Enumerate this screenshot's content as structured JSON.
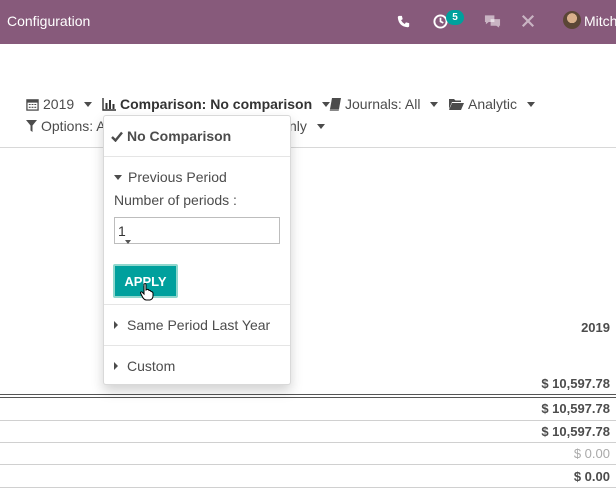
{
  "header": {
    "title": "Configuration",
    "activity_count": "5",
    "user_name": "Mitch",
    "icons": [
      "phone-icon",
      "clock-icon",
      "chat-icon",
      "tools-icon",
      "avatar"
    ]
  },
  "filters": {
    "year_label": "2019",
    "comparison_label": "Comparison: No comparison",
    "journals_label": "Journals: All",
    "analytic_label": "Analytic",
    "options_label_left": "Options: A",
    "options_label_right": "nly"
  },
  "comparison_dropdown": {
    "no_comparison": "No Comparison",
    "previous_period": "Previous Period",
    "periods_label": "Number of periods :",
    "periods_value": "1",
    "apply_label": "APPLY",
    "same_period_last_year": "Same Period Last Year",
    "custom": "Custom"
  },
  "report": {
    "column_header": "2019",
    "amounts": [
      "$ 10,597.78",
      "$ 10,597.78",
      "$ 10,597.78",
      "$ 0.00",
      "$ 0.00"
    ]
  },
  "colors": {
    "topbar": "#875a7b",
    "accent": "#00a09d"
  }
}
